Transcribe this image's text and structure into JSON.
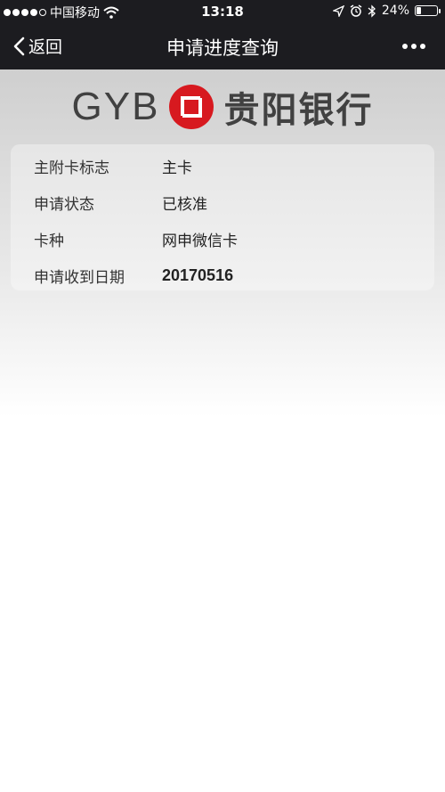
{
  "status_bar": {
    "carrier": "中国移动",
    "time": "13:18",
    "battery": "24%",
    "battery_level": 0.24
  },
  "nav": {
    "back_label": "返回",
    "title": "申请进度查询"
  },
  "logo": {
    "latin": "GYB",
    "name": "贵阳银行",
    "brand_color": "#d7191f"
  },
  "details": [
    {
      "label": "主附卡标志",
      "value": "主卡"
    },
    {
      "label": "申请状态",
      "value": "已核准"
    },
    {
      "label": "卡种",
      "value": "网申微信卡"
    },
    {
      "label": "申请收到日期",
      "value": "20170516"
    }
  ]
}
